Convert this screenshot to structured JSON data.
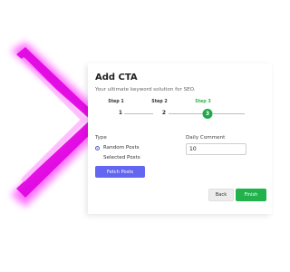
{
  "modal": {
    "title": "Add CTA",
    "subtitle": "Your ultimate keyword solution for SEO."
  },
  "stepper": {
    "steps": [
      {
        "label": "Step 1",
        "number": "1",
        "state": "done"
      },
      {
        "label": "Step 2",
        "number": "2",
        "state": "done"
      },
      {
        "label": "Step 3",
        "number": "3",
        "state": "active"
      }
    ],
    "active_color": "#1fa94a"
  },
  "form": {
    "type_label": "Type",
    "options": [
      {
        "label": "Random Posts",
        "selected": true
      },
      {
        "label": "Selected Posts",
        "selected": false
      }
    ],
    "fetch_label": "Fetch Posts",
    "daily_comment_label": "Daily Comment",
    "daily_comment_value": "10"
  },
  "actions": {
    "back_label": "Back",
    "finish_label": "Finish"
  },
  "colors": {
    "primary": "#6366f1",
    "success": "#22b24c",
    "decor": "#ff00ff"
  },
  "decor": {
    "icon": "chevron-right-icon"
  }
}
